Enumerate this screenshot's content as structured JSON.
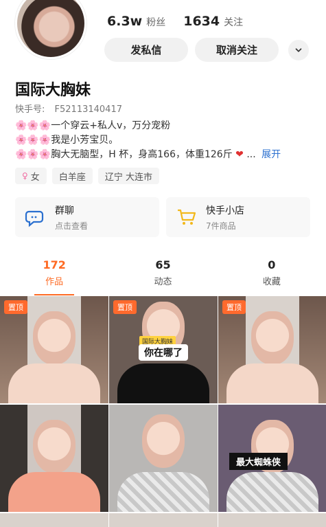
{
  "header": {
    "followers_value": "6.3w",
    "followers_label": "粉丝",
    "following_value": "1634",
    "following_label": "关注",
    "btn_message": "发私信",
    "btn_unfollow": "取消关注"
  },
  "profile": {
    "name": "国际大胸妹",
    "kid_label": "快手号:",
    "kid_value": "F52113140417",
    "bio": [
      "🌸🌸🌸一个穿云+私人v，万分宠粉",
      "🌸🌸🌸我是小芳宝贝。",
      "🌸🌸🌸胸大无脑型，H 杯，身高166，体重126斤"
    ],
    "bio_more": "...",
    "bio_expand": "展开",
    "tags": [
      {
        "symbol": "♀",
        "text": "女"
      },
      {
        "symbol": "",
        "text": "白羊座"
      },
      {
        "symbol": "",
        "text": "辽宁 大连市"
      }
    ]
  },
  "cards": {
    "group": {
      "title": "群聊",
      "subtitle": "点击查看"
    },
    "shop": {
      "title": "快手小店",
      "subtitle": "7件商品"
    }
  },
  "tabs": [
    {
      "count": "172",
      "label": "作品"
    },
    {
      "count": "65",
      "label": "动态"
    },
    {
      "count": "0",
      "label": "收藏"
    }
  ],
  "grid": {
    "pinned_label": "置顶",
    "tile2_small_text": "国际大胸妹",
    "tile2_label": "你在哪了",
    "tile6_label": "最大蜘蛛侠"
  },
  "colors": {
    "accent": "#fe6a23",
    "link": "#2a6fcf"
  }
}
